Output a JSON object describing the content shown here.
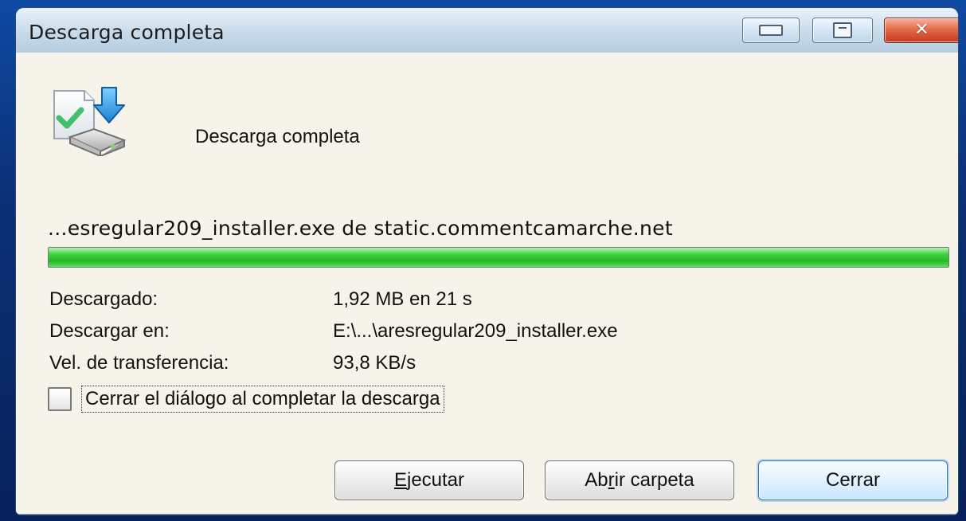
{
  "window": {
    "title": "Descarga completa",
    "controls": {
      "minimize_icon": "minimize-icon",
      "maximize_icon": "maximize-icon",
      "close_icon": "close-icon"
    }
  },
  "header": {
    "icon": "download-complete-icon",
    "title": "Descarga completa"
  },
  "download": {
    "source_line": "...esregular209_installer.exe de static.commentcamarche.net",
    "progress_fraction": 1.0,
    "progress_color": "#24b824"
  },
  "details": {
    "rows": [
      {
        "label": "Descargado:",
        "value": "1,92 MB en 21 s"
      },
      {
        "label": "Descargar en:",
        "value": "E:\\...\\aresregular209_installer.exe"
      },
      {
        "label": "Vel. de transferencia:",
        "value": "93,8 KB/s"
      }
    ]
  },
  "options": {
    "close_on_complete_label": "Cerrar el diálogo al completar la descarga",
    "close_on_complete_checked": false
  },
  "buttons": {
    "run": {
      "pre": "",
      "accel": "E",
      "post": "jecutar"
    },
    "open_folder": {
      "pre": "Ab",
      "accel": "r",
      "post": "ir carpeta"
    },
    "close": {
      "label": "Cerrar"
    }
  }
}
